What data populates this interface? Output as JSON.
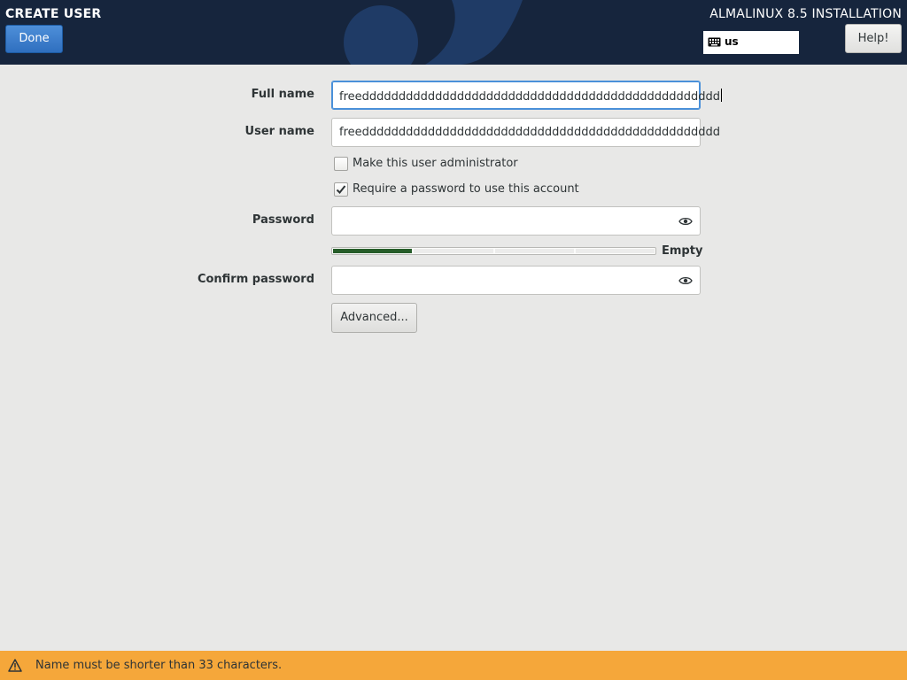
{
  "header": {
    "spoke_title": "CREATE USER",
    "done_label": "Done",
    "product_title": "ALMALINUX 8.5 INSTALLATION",
    "keyboard_layout": "us",
    "help_label": "Help!"
  },
  "form": {
    "full_name_label": "Full name",
    "full_name_value": "freeddddddddddddddddddddddddddddddddddddddddddddddddd",
    "user_name_label": "User name",
    "user_name_value": "freeddddddddddddddddddddddddddddddddddddddddddddddddd",
    "admin_checkbox_label": "Make this user administrator",
    "admin_checked": false,
    "require_password_label": "Require a password to use this account",
    "require_password_checked": true,
    "password_label": "Password",
    "password_value": "",
    "strength_level": 0.25,
    "strength_text": "Empty",
    "confirm_password_label": "Confirm password",
    "confirm_password_value": "",
    "advanced_label": "Advanced..."
  },
  "infobar": {
    "message": "Name must be shorter than 33 characters."
  },
  "colors": {
    "header_bg": "#16253d",
    "done_button": "#3a7bcc",
    "focus_border": "#4a90d9",
    "strength_fill": "#265d29",
    "warning_bar": "#f5a73a",
    "page_bg": "#e8e8e7"
  },
  "icons": {
    "keyboard": "keyboard-icon",
    "reveal_password": "eye-icon",
    "warning": "warning-icon",
    "checkbox_mark": "checkmark-icon"
  }
}
